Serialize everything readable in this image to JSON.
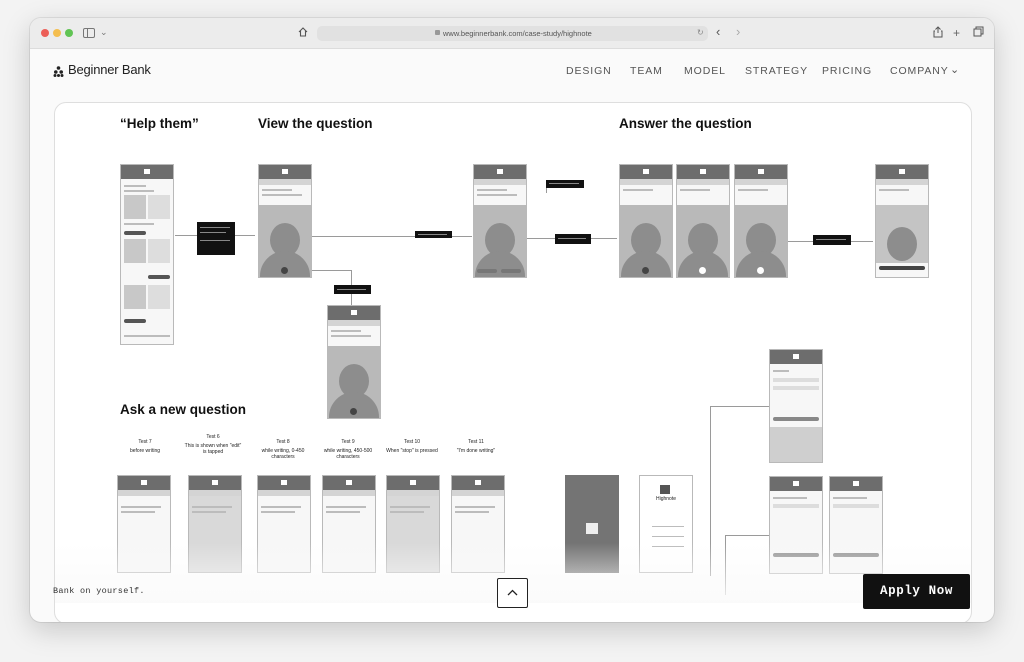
{
  "browser": {
    "url": "www.beginnerbank.com/case-study/highnote",
    "traffic_light_colors": [
      "#ec5f58",
      "#f4be4f",
      "#61c454"
    ]
  },
  "site": {
    "brand": "Beginner Bank",
    "nav": [
      "DESIGN",
      "TEAM",
      "MODEL",
      "STRATEGY",
      "PRICING",
      "COMPANY"
    ]
  },
  "content": {
    "sections": {
      "help_them": "“Help them”",
      "view_question": "View the question",
      "answer_question": "Answer the question",
      "ask_new": "Ask a new question"
    },
    "test_labels": [
      {
        "title": "Test 7",
        "sub": "before writing"
      },
      {
        "title": "Test 6",
        "sub": "This is shown when \"edit\" is tapped"
      },
      {
        "title": "Test 8",
        "sub": "while writing, 0-450 characters"
      },
      {
        "title": "Test 9",
        "sub": "while writing, 450-500 characters"
      },
      {
        "title": "Test 10",
        "sub": "When \"stop\" is pressed"
      },
      {
        "title": "Test 11",
        "sub": "\"I'm done writing\""
      }
    ],
    "onboarding_app_name": "Highnote"
  },
  "footer": {
    "tagline": "Bank on yourself.",
    "apply_label": "Apply Now"
  }
}
